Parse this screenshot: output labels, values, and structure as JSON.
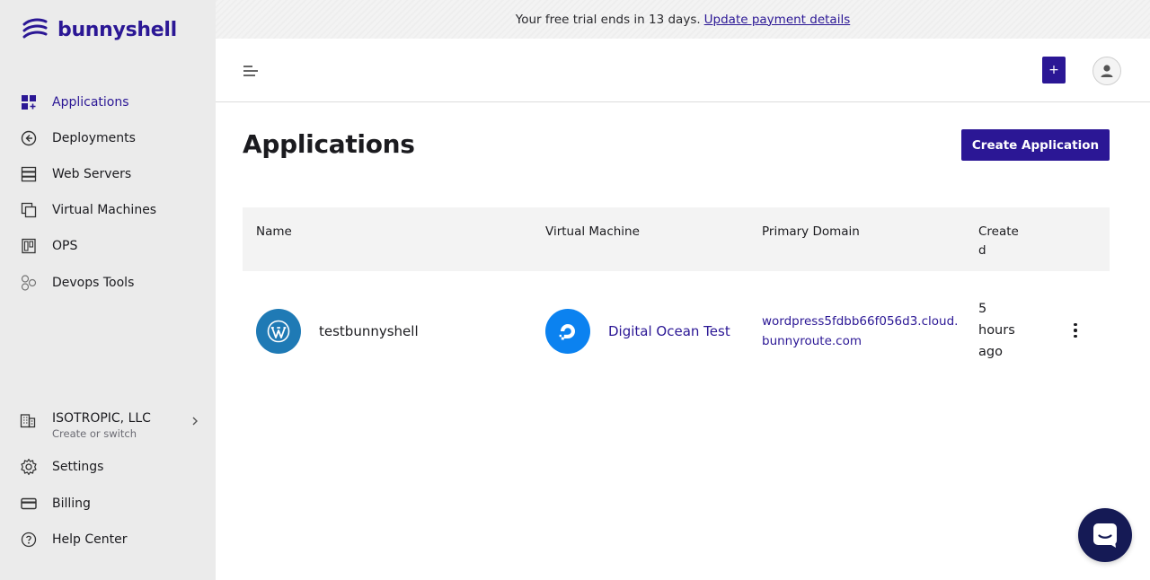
{
  "brand": {
    "name": "bunnyshell",
    "color": "#2b1795"
  },
  "banner": {
    "text": "Your free trial ends in 13 days.",
    "link": "Update payment details"
  },
  "sidebar": {
    "items": [
      {
        "label": "Applications",
        "icon": "grid-plus-icon",
        "active": true
      },
      {
        "label": "Deployments",
        "icon": "deploy-icon"
      },
      {
        "label": "Web Servers",
        "icon": "server-icon"
      },
      {
        "label": "Virtual Machines",
        "icon": "stack-icon"
      },
      {
        "label": "OPS",
        "icon": "ops-icon"
      },
      {
        "label": "Devops Tools",
        "icon": "molecule-icon"
      }
    ],
    "org": {
      "name": "ISOTROPIC, LLC",
      "sub": "Create or switch"
    },
    "bottom": [
      {
        "label": "Settings",
        "icon": "gear-icon"
      },
      {
        "label": "Billing",
        "icon": "credit-card-icon"
      },
      {
        "label": "Help Center",
        "icon": "help-icon"
      }
    ]
  },
  "topbar": {
    "plus_label": "+"
  },
  "main": {
    "title": "Applications",
    "create_button": "Create Application",
    "columns": [
      "Name",
      "Virtual Machine",
      "Primary Domain",
      "Create",
      "d"
    ],
    "rows": [
      {
        "name": "testbunnyshell",
        "vm": "Digital Ocean Test",
        "domain_line1": "wordpress5fdbb66f056d3.cloud.",
        "domain_line2": "bunnyroute.com",
        "created_1": "5",
        "created_2": "hours",
        "created_3": "ago"
      }
    ]
  }
}
